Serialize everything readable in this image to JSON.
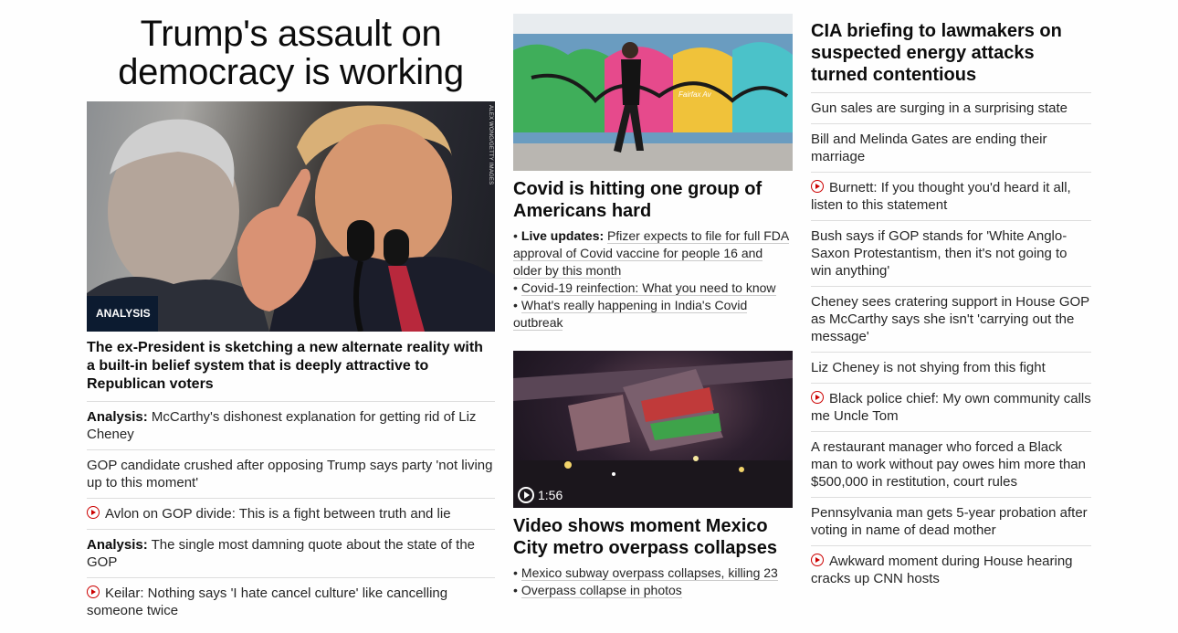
{
  "left": {
    "headline": "Trump's assault on democracy is working",
    "image_credit": "ALEX WONG/GETTY IMAGES",
    "badge": "ANALYSIS",
    "subheadline": "The ex-President is sketching a new alternate reality with a built-in belief system that is deeply attractive to Republican voters",
    "items": [
      {
        "prefix": "Analysis:",
        "text": "McCarthy's dishonest explanation for getting rid of Liz Cheney",
        "video": false
      },
      {
        "prefix": "",
        "text": "GOP candidate crushed after opposing Trump says party 'not living up to this moment'",
        "video": false
      },
      {
        "prefix": "",
        "text": "Avlon on GOP divide: This is a fight between truth and lie",
        "video": true
      },
      {
        "prefix": "Analysis:",
        "text": "The single most damning quote about the state of the GOP",
        "video": false
      },
      {
        "prefix": "",
        "text": "Keilar: Nothing says 'I hate cancel culture' like cancelling someone twice",
        "video": true
      }
    ]
  },
  "middle": {
    "story1": {
      "headline": "Covid is hitting one group of Americans hard",
      "image_caption": "Fairfax Av",
      "bullets": [
        {
          "prefix": "Live updates:",
          "text": "Pfizer expects to file for full FDA approval of Covid vaccine for people 16 and older by this month"
        },
        {
          "prefix": "",
          "text": "Covid-19 reinfection: What you need to know"
        },
        {
          "prefix": "",
          "text": "What's really happening in India's Covid outbreak"
        }
      ]
    },
    "story2": {
      "headline": "Video shows moment Mexico City metro overpass collapses",
      "video_duration": "1:56",
      "bullets": [
        {
          "text": "Mexico subway overpass collapses, killing 23"
        },
        {
          "text": "Overpass collapse in photos"
        }
      ]
    }
  },
  "right": {
    "headline": "CIA briefing to lawmakers on suspected energy attacks turned contentious",
    "items": [
      {
        "text": "Gun sales are surging in a surprising state",
        "video": false
      },
      {
        "text": "Bill and Melinda Gates are ending their marriage",
        "video": false
      },
      {
        "text": "Burnett: If you thought you'd heard it all, listen to this statement",
        "video": true
      },
      {
        "text": "Bush says if GOP stands for 'White Anglo-Saxon Protestantism, then it's not going to win anything'",
        "video": false
      },
      {
        "text": "Cheney sees cratering support in House GOP as McCarthy says she isn't 'carrying out the message'",
        "video": false
      },
      {
        "text": "Liz Cheney is not shying from this fight",
        "video": false
      },
      {
        "text": "Black police chief: My own community calls me Uncle Tom",
        "video": true
      },
      {
        "text": "A restaurant manager who forced a Black man to work without pay owes him more than $500,000 in restitution, court rules",
        "video": false
      },
      {
        "text": "Pennsylvania man gets 5-year probation after voting in name of dead mother",
        "video": false
      },
      {
        "text": "Awkward moment during House hearing cracks up CNN hosts",
        "video": true
      }
    ]
  },
  "colors": {
    "accent_red": "#cc0000",
    "badge_navy": "#0c1b30",
    "divider": "#dddddd"
  }
}
